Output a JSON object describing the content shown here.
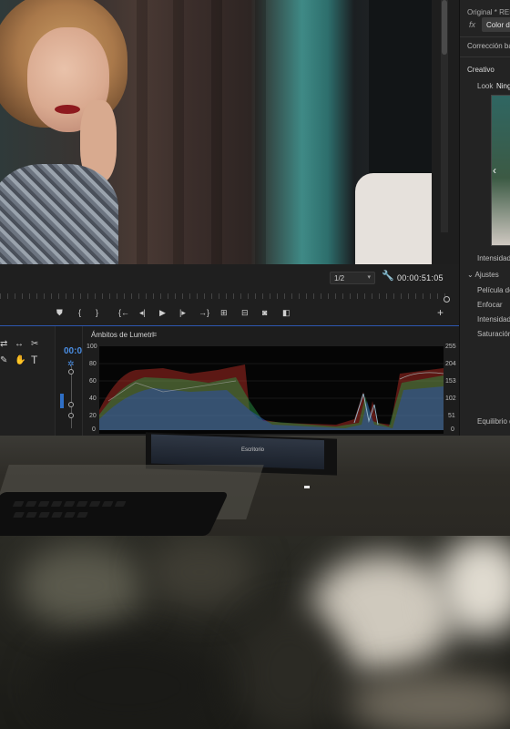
{
  "lumetri_panel": {
    "header": "Original * RED",
    "fx_label": "fx",
    "tab": "Color de",
    "section_basic": "Corrección básic",
    "section_creative": "Creativo",
    "look_label": "Look",
    "look_value": "Ning",
    "intensity_label": "Intensidad",
    "adjustments_label": "Ajustes",
    "faded_film_label": "Película desv",
    "sharpen_label": "Enfocar",
    "intensity2_label": "Intensidad",
    "saturation_label": "Saturación",
    "balance_label": "Equilibrio de"
  },
  "program_monitor": {
    "zoom_value": "1/2",
    "timecode": "00:00:51:05"
  },
  "transport": {
    "buttons": [
      "marker",
      "in-point",
      "out-point",
      "go-to-in",
      "step-back",
      "play",
      "step-forward",
      "go-to-out",
      "insert",
      "overwrite",
      "export-frame",
      "compare",
      "add"
    ]
  },
  "tracks_panel": {
    "timecode_short": "00:0"
  },
  "scopes": {
    "title": "Ámbitos de Lumetri",
    "left_scale": [
      "100",
      "80",
      "60",
      "40",
      "20",
      "0"
    ],
    "right_scale": [
      "255",
      "204",
      "153",
      "102",
      "51",
      "0"
    ]
  },
  "taskbar": {
    "text": "Escritorio"
  },
  "colors": {
    "accent_blue": "#2f6fc6",
    "lips_red": "#8e1a1e",
    "teal_wall": "#3f8a86"
  }
}
